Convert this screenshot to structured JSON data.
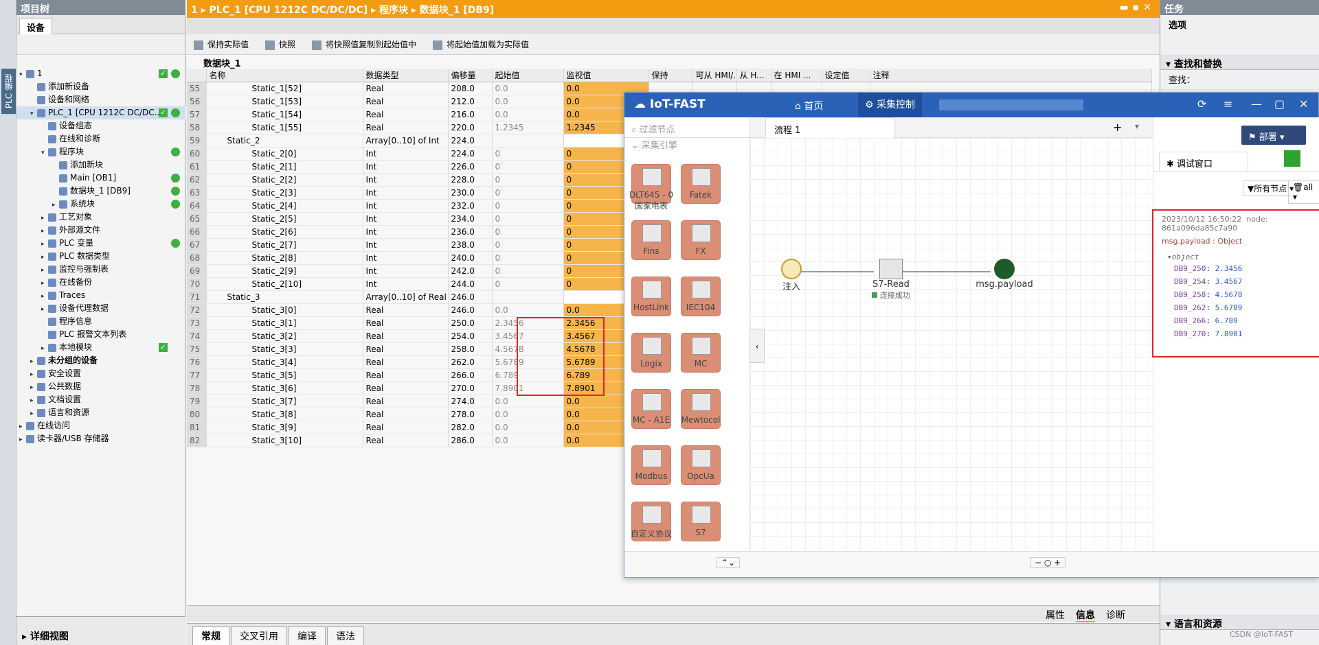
{
  "rail": {
    "label": "PLC 编程"
  },
  "tree": {
    "title": "项目树",
    "tab": "设备",
    "items": [
      {
        "label": "1",
        "lvl": 0,
        "tw": "▾",
        "chk": true,
        "ok": true
      },
      {
        "label": "添加新设备",
        "lvl": 1
      },
      {
        "label": "设备和网络",
        "lvl": 1
      },
      {
        "label": "PLC_1 [CPU 1212C DC/DC...",
        "lvl": 1,
        "tw": "▾",
        "sel": true,
        "chk": true,
        "ok": true
      },
      {
        "label": "设备组态",
        "lvl": 2
      },
      {
        "label": "在线和诊断",
        "lvl": 2
      },
      {
        "label": "程序块",
        "lvl": 2,
        "tw": "▾",
        "ok": true
      },
      {
        "label": "添加新块",
        "lvl": 3
      },
      {
        "label": "Main [OB1]",
        "lvl": 3,
        "ok": true
      },
      {
        "label": "数据块_1 [DB9]",
        "lvl": 3,
        "ok": true
      },
      {
        "label": "系统块",
        "lvl": 3,
        "tw": "▸",
        "ok": true
      },
      {
        "label": "工艺对象",
        "lvl": 2,
        "tw": "▸"
      },
      {
        "label": "外部源文件",
        "lvl": 2,
        "tw": "▸"
      },
      {
        "label": "PLC 变量",
        "lvl": 2,
        "tw": "▸",
        "ok": true
      },
      {
        "label": "PLC 数据类型",
        "lvl": 2,
        "tw": "▸"
      },
      {
        "label": "监控与强制表",
        "lvl": 2,
        "tw": "▸"
      },
      {
        "label": "在线备份",
        "lvl": 2,
        "tw": "▸"
      },
      {
        "label": "Traces",
        "lvl": 2,
        "tw": "▸"
      },
      {
        "label": "设备代理数据",
        "lvl": 2,
        "tw": "▸"
      },
      {
        "label": "程序信息",
        "lvl": 2
      },
      {
        "label": "PLC 报警文本列表",
        "lvl": 2
      },
      {
        "label": "本地模块",
        "lvl": 2,
        "tw": "▸",
        "chk": true
      },
      {
        "label": "未分组的设备",
        "lvl": 1,
        "tw": "▸",
        "bold": true
      },
      {
        "label": "安全设置",
        "lvl": 1,
        "tw": "▸"
      },
      {
        "label": "公共数据",
        "lvl": 1,
        "tw": "▸"
      },
      {
        "label": "文档设置",
        "lvl": 1,
        "tw": "▸"
      },
      {
        "label": "语言和资源",
        "lvl": 1,
        "tw": "▸"
      },
      {
        "label": "在线访问",
        "lvl": 0,
        "tw": "▸"
      },
      {
        "label": "读卡器/USB 存储器",
        "lvl": 0,
        "tw": "▸"
      }
    ],
    "details": "详细视图"
  },
  "editor": {
    "title": "1 ▸ PLC_1 [CPU 1212C DC/DC/DC] ▸ 程序块 ▸ 数据块_1 [DB9]",
    "toolbar": [
      "保持实际值",
      "快照",
      "将快照值复制到起始值中",
      "将起始值加载为实际值"
    ],
    "block_name": "数据块_1",
    "headers": [
      "",
      "名称",
      "数据类型",
      "偏移量",
      "起始值",
      "监视值",
      "保持",
      "可从 HMI/...",
      "从 H...",
      "在 HMI ...",
      "设定值",
      "注释"
    ],
    "rows": [
      [
        "55",
        "Static_1[52]",
        "Real",
        "208.0",
        "0.0",
        "0.0"
      ],
      [
        "56",
        "Static_1[53]",
        "Real",
        "212.0",
        "0.0",
        "0.0"
      ],
      [
        "57",
        "Static_1[54]",
        "Real",
        "216.0",
        "0.0",
        "0.0"
      ],
      [
        "58",
        "Static_1[55]",
        "Real",
        "220.0",
        "1.2345",
        "1.2345"
      ],
      [
        "59",
        "Static_2",
        "Array[0..10] of Int",
        "224.0",
        "",
        ""
      ],
      [
        "60",
        "Static_2[0]",
        "Int",
        "224.0",
        "0",
        "0"
      ],
      [
        "61",
        "Static_2[1]",
        "Int",
        "226.0",
        "0",
        "0"
      ],
      [
        "62",
        "Static_2[2]",
        "Int",
        "228.0",
        "0",
        "0"
      ],
      [
        "63",
        "Static_2[3]",
        "Int",
        "230.0",
        "0",
        "0"
      ],
      [
        "64",
        "Static_2[4]",
        "Int",
        "232.0",
        "0",
        "0"
      ],
      [
        "65",
        "Static_2[5]",
        "Int",
        "234.0",
        "0",
        "0"
      ],
      [
        "66",
        "Static_2[6]",
        "Int",
        "236.0",
        "0",
        "0"
      ],
      [
        "67",
        "Static_2[7]",
        "Int",
        "238.0",
        "0",
        "0"
      ],
      [
        "68",
        "Static_2[8]",
        "Int",
        "240.0",
        "0",
        "0"
      ],
      [
        "69",
        "Static_2[9]",
        "Int",
        "242.0",
        "0",
        "0"
      ],
      [
        "70",
        "Static_2[10]",
        "Int",
        "244.0",
        "0",
        "0"
      ],
      [
        "71",
        "Static_3",
        "Array[0..10] of Real",
        "246.0",
        "",
        ""
      ],
      [
        "72",
        "Static_3[0]",
        "Real",
        "246.0",
        "0.0",
        "0.0"
      ],
      [
        "73",
        "Static_3[1]",
        "Real",
        "250.0",
        "2.3456",
        "2.3456"
      ],
      [
        "74",
        "Static_3[2]",
        "Real",
        "254.0",
        "3.4567",
        "3.4567"
      ],
      [
        "75",
        "Static_3[3]",
        "Real",
        "258.0",
        "4.5678",
        "4.5678"
      ],
      [
        "76",
        "Static_3[4]",
        "Real",
        "262.0",
        "5.6789",
        "5.6789"
      ],
      [
        "77",
        "Static_3[5]",
        "Real",
        "266.0",
        "6.789",
        "6.789"
      ],
      [
        "78",
        "Static_3[6]",
        "Real",
        "270.0",
        "7.8901",
        "7.8901"
      ],
      [
        "79",
        "Static_3[7]",
        "Real",
        "274.0",
        "0.0",
        "0.0"
      ],
      [
        "80",
        "Static_3[8]",
        "Real",
        "278.0",
        "0.0",
        "0.0"
      ],
      [
        "81",
        "Static_3[9]",
        "Real",
        "282.0",
        "0.0",
        "0.0"
      ],
      [
        "82",
        "Static_3[10]",
        "Real",
        "286.0",
        "0.0",
        "0.0"
      ]
    ],
    "infotabs": [
      "属性",
      "信息",
      "诊断"
    ],
    "bottomtabs": [
      "常规",
      "交叉引用",
      "编译",
      "语法"
    ]
  },
  "tasks": {
    "title": "任务",
    "options": "选项",
    "find": "查找和替换",
    "find_label": "查找：",
    "lang": "语言和资源"
  },
  "iot": {
    "logo": "IoT-FAST",
    "nav_home": "首页",
    "nav_collect": "采集控制",
    "filter": "过滤节点",
    "category": "采集引擎",
    "palette": [
      "DLT645 - 0 国家电表",
      "Fatek",
      "Fins",
      "FX",
      "HostLink",
      "IEC104",
      "Logix",
      "MC",
      "MC - A1E",
      "Mewtocol",
      "Modbus",
      "OpcUa",
      "自定义协议",
      "S7"
    ],
    "flow_tab": "流程 1",
    "nodes": {
      "inject": "注入",
      "s7": "S7-Read",
      "s7_status": "连接成功",
      "debug": "msg.payload"
    },
    "deploy": "部署",
    "debug_tab": "调试窗口",
    "filter_nodes": "所有节点",
    "filter_all": "all",
    "msg": {
      "time": "2023/10/12 16:50:22",
      "node": "node: 861a096da85c7a90",
      "topic": "msg.payload : Object",
      "obj": "object",
      "items": [
        {
          "k": "DB9_250",
          "v": "2.3456"
        },
        {
          "k": "DB9_254",
          "v": "3.4567"
        },
        {
          "k": "DB9_258",
          "v": "4.5678"
        },
        {
          "k": "DB9_262",
          "v": "5.6789"
        },
        {
          "k": "DB9_266",
          "v": "6.789"
        },
        {
          "k": "DB9_270",
          "v": "7.8901"
        }
      ]
    }
  },
  "watermark": "CSDN @IoT-FAST"
}
